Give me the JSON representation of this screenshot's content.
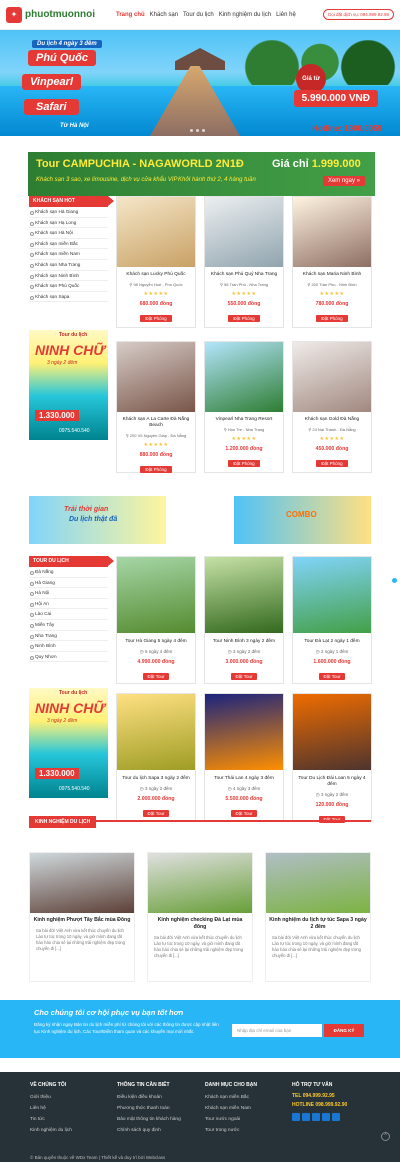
{
  "header": {
    "logo": "phuotmuonnoi",
    "nav": [
      "Trang chủ",
      "Khách sạn",
      "Tour du lịch",
      "Kinh nghiệm du lịch",
      "Liên hệ"
    ],
    "hotline_button": "Gọi đặt dịch vụ: 094.999.92.95"
  },
  "hero": {
    "tag1": "Du lịch 4 ngày 3 đêm",
    "tag2": "Phú Quốc",
    "tag3": "Vinpearl",
    "tag4": "Safari",
    "tag5": "Từ Hà Nội",
    "price_label": "Giá từ",
    "price": "5.990.000 VNĐ",
    "hotline": "Hotline: 1900.0059"
  },
  "promo_banner": {
    "title": "Tour CAMPUCHIA - NAGAWORLD 2N1Đ",
    "price_prefix": "Giá chỉ",
    "price": "1.999.000",
    "line1": "Khách sạn 3 sao, xe limousine, dịch vụ cửa khẩu VIP",
    "line2": "Khởi hành thứ 2, 4 hàng tuần",
    "button": "Xem ngay »"
  },
  "hotel_sidebar": {
    "heading": "KHÁCH SẠN HOT",
    "items": [
      "Khách sạn Hà Giang",
      "Khách sạn Hạ Long",
      "Khách sạn Hà Nội",
      "Khách sạn miền Bắc",
      "Khách sạn miền Nam",
      "Khách sạn Nha Trang",
      "Khách sạn Ninh Bình",
      "Khách sạn Phú Quốc",
      "Khách sạn Sapa"
    ]
  },
  "side_promo": {
    "label": "Tour du lịch",
    "title": "NINH CHỮ",
    "duration": "3 ngày 2 đêm",
    "price": "1.330.000",
    "phone": "0975.540.540"
  },
  "hotels": [
    {
      "name": "Khách sạn Lucky Phú Quốc",
      "addr": "98 Nguyễn Huệ - Phú Quốc",
      "price": "680.000 đồng",
      "btn": "Đặt Phòng",
      "colors": [
        "#f5e6c8",
        "#c8a165"
      ]
    },
    {
      "name": "Khách sạn Phú Quý Nha Trang",
      "addr": "98 Trần Phú - Nha Trang",
      "price": "550.000 đồng",
      "btn": "Đặt Phòng",
      "colors": [
        "#eceff1",
        "#90a4ae"
      ]
    },
    {
      "name": "Khách sạn Maria Ninh Bình",
      "addr": "200 Trần Phú - Ninh Bình",
      "price": "780.000 đồng",
      "btn": "Đặt Phòng",
      "colors": [
        "#fff3e0",
        "#8d6e63"
      ]
    },
    {
      "name": "Khách sạn A La Carte Đà Nẵng Beach",
      "addr": "200 Võ Nguyên Giáp - Đà Nẵng",
      "price": "880.000 đồng",
      "btn": "Đặt Phòng",
      "colors": [
        "#d7ccc8",
        "#795548"
      ]
    },
    {
      "name": "Vinpearl Nha Trang Resort",
      "addr": "Hòn Tre - Nha Trang",
      "price": "1.200.000 đồng",
      "btn": "Đặt Phòng",
      "colors": [
        "#b3e5fc",
        "#2e7d32"
      ]
    },
    {
      "name": "Khách sạn Gold Đà Nẵng",
      "addr": "24 Nại Thành - Đà Nẵng",
      "price": "450.000 đồng",
      "btn": "Đặt Phòng",
      "colors": [
        "#efebe9",
        "#a1887f"
      ]
    }
  ],
  "hotel_stars": "★★★★★",
  "ads": {
    "ad1_text1": "Trải thời gian",
    "ad1_text2": "Du lịch thật đã",
    "ad2_text": "COMBO"
  },
  "tour_sidebar": {
    "heading": "TOUR DU LỊCH",
    "items": [
      "Đà Nẵng",
      "Hà Giang",
      "Hà Nội",
      "Hội An",
      "Lào Cai",
      "Miền Tây",
      "Nha Trang",
      "Ninh Bình",
      "Quy Nhơn"
    ]
  },
  "tours": [
    {
      "name": "Tour Hà Giang 5 ngày 4 đêm",
      "dur": "5 ngày 4 đêm",
      "price": "4.990.000 đồng",
      "btn": "Đặt Tour",
      "colors": [
        "#a5d6a7",
        "#558b2f"
      ]
    },
    {
      "name": "Tour Ninh Bình 3 ngày 2 đêm",
      "dur": "3 ngày 2 đêm",
      "price": "3.000.000 đồng",
      "btn": "Đặt Tour",
      "colors": [
        "#c5e1a5",
        "#33691e"
      ]
    },
    {
      "name": "Tour Đà Lạt 2 ngày 1 đêm",
      "dur": "2 ngày 1 đêm",
      "price": "1.600.000 đồng",
      "btn": "Đặt Tour",
      "colors": [
        "#81d4fa",
        "#43a047"
      ]
    },
    {
      "name": "Tour du lịch Sapa 3 ngày 2 đêm",
      "dur": "3 ngày 2 đêm",
      "price": "2.000.000 đồng",
      "btn": "Đặt Tour",
      "colors": [
        "#ffe082",
        "#9e9d24"
      ]
    },
    {
      "name": "Tour Thái Lan 4 ngày 3 đêm",
      "dur": "4 ngày 3 đêm",
      "price": "5.500.000 đồng",
      "btn": "Đặt Tour",
      "colors": [
        "#1a237e",
        "#ff8f00"
      ]
    },
    {
      "name": "Tour Du Lịch Đài Loan 5 ngày 4 đêm",
      "dur": "3 ngày 2 đêm",
      "price": "120.000 đồng",
      "btn": "Đặt Tour",
      "colors": [
        "#ef6c00",
        "#4e342e"
      ]
    }
  ],
  "experience": {
    "heading": "KINH NGHIỆM DU LỊCH",
    "posts": [
      {
        "title": "Kinh nghiệm Phượt Tây Bắc mùa Đông",
        "desc": "Sa bài đời Việt Anh vừa kết thúc chuyến du lịch Lào tự túc trong 10 ngày, và giờ mình đang tất háo háo chia sẻ lại những trải nghiệm đẹp trong chuyến đi [...]",
        "colors": [
          "#cfd8dc",
          "#5d4037"
        ]
      },
      {
        "title": "Kinh nghiệm checking Đà Lạt mùa đông",
        "desc": "Sa bài đời Việt Anh vừa kết thúc chuyến du lịch Lào tự túc trong 10 ngày, và giờ mình đang tất háo háo chia sẻ lại những trải nghiệm đẹp trong chuyến đi [...]",
        "colors": [
          "#e0e0e0",
          "#689f38"
        ]
      },
      {
        "title": "Kinh nghiệm du lịch tự túc Sapa 3 ngày 2 đêm",
        "desc": "Sa bài đời Việt Anh vừa kết thúc chuyến du lịch Lào tự túc trong 10 ngày, và giờ mình đang tất háo háo chia sẻ lại những trải nghiệm đẹp trong chuyến đi [...]",
        "colors": [
          "#b0bec5",
          "#7cb342"
        ]
      }
    ]
  },
  "subscribe": {
    "title": "Cho chúng tôi cơ hội phục vụ bạn tốt hơn",
    "text": "Đăng ký nhận ngay Bản tin du lịch miễn phí từ chúng tôi với các thông tin được cập nhật liên tục Kinh nghiệm du lịch, Các Tour/Điểm tham quan và các khuyến mại mới nhất.",
    "placeholder": "Nhập địa chỉ email của bạn",
    "button": "ĐĂNG KÝ"
  },
  "footer": {
    "col1": {
      "heading": "VỀ CHÚNG TÔI",
      "items": [
        "Giới thiệu",
        "Liên hệ",
        "Tin tức",
        "Kinh nghiệm du lịch"
      ]
    },
    "col2": {
      "heading": "THÔNG TIN CẦN BIẾT",
      "items": [
        "Điều kiện điều khoản",
        "Phương thức thanh toán",
        "Bảo mật thông tin khách hàng",
        "Chính sách quy định"
      ]
    },
    "col3": {
      "heading": "DANH MỤC CHO BẠN",
      "items": [
        "Khách sạn miền Bắc",
        "Khách sạn miền Nam",
        "Tour nước ngoài",
        "Tour trong nước"
      ]
    },
    "col4": {
      "heading": "HỖ TRỢ TƯ VẤN",
      "tel": "TEL 094.999.92.95",
      "hotline": "HOTLINE 098.999.92.90"
    },
    "copyright": "© Bản quyền thuộc về WDx Team | Thiết kế và duy trì bởi Webclass"
  },
  "colors": {
    "accent": "#e53935",
    "green": "#2e7d32",
    "blue": "#29b6f6"
  }
}
